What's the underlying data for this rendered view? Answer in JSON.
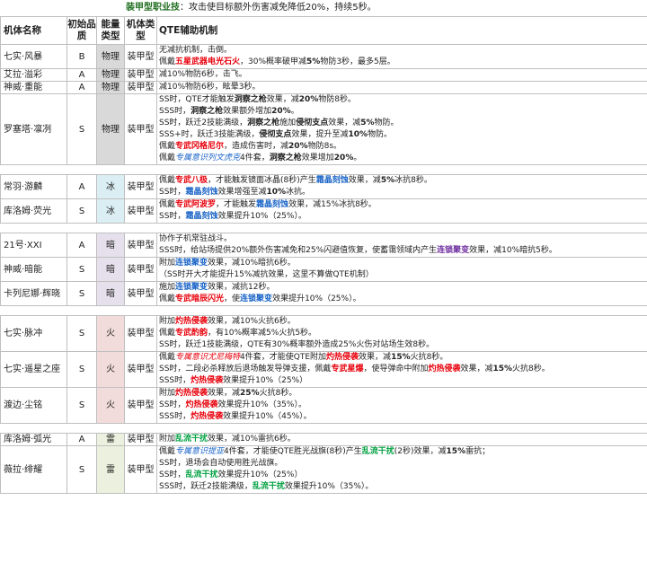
{
  "intro": {
    "label": "装甲型职业技",
    "text": "：攻击使目标额外伤害减免降低20%，持续5秒。"
  },
  "headers": {
    "name": "机体名称",
    "grade": "初始品质",
    "etype": "能量类型",
    "mtype": "机体类型",
    "mech": "QTE辅助机制"
  },
  "rows": [
    {
      "name": "七实·风暴",
      "grade": "B",
      "etype": "物理",
      "mtype": "装甲型",
      "lines": [
        [
          {
            "t": "无减抗机制，击倒。"
          }
        ],
        [
          {
            "t": "佩戴"
          },
          {
            "t": "五星武器电光石火",
            "c": "r"
          },
          {
            "t": "，30%概率破甲减"
          },
          {
            "t": "5%",
            "c": "k"
          },
          {
            "t": "物防3秒，最多5层。"
          }
        ]
      ]
    },
    {
      "name": "艾拉·溢彩",
      "grade": "A",
      "etype": "物理",
      "mtype": "装甲型",
      "lines": [
        [
          {
            "t": "减10%物防6秒，击飞。"
          }
        ]
      ]
    },
    {
      "name": "神威·重能",
      "grade": "A",
      "etype": "物理",
      "mtype": "装甲型",
      "lines": [
        [
          {
            "t": "减10%物防6秒，眩晕3秒。"
          }
        ]
      ]
    },
    {
      "name": "罗塞塔·凛冽",
      "grade": "S",
      "etype": "物理",
      "mtype": "装甲型",
      "lines": [
        [
          {
            "t": "SS时，QTE才能触发"
          },
          {
            "t": "洞察之枪",
            "c": "k"
          },
          {
            "t": "效果，减"
          },
          {
            "t": "20%",
            "c": "k"
          },
          {
            "t": "物防8秒。"
          }
        ],
        [
          {
            "t": "SSS时，"
          },
          {
            "t": "洞察之枪",
            "c": "k"
          },
          {
            "t": "效果额外增加"
          },
          {
            "t": "20%",
            "c": "k"
          },
          {
            "t": "。"
          }
        ],
        [
          {
            "t": "SS时，跃迁2技能满级，"
          },
          {
            "t": "洞察之枪",
            "c": "k"
          },
          {
            "t": "施加"
          },
          {
            "t": "侵彻支点",
            "c": "k"
          },
          {
            "t": "效果，减"
          },
          {
            "t": "5%",
            "c": "k"
          },
          {
            "t": "物防。"
          }
        ],
        [
          {
            "t": "SSS+时，跃迁3技能满级，"
          },
          {
            "t": "侵彻支点",
            "c": "k"
          },
          {
            "t": "效果，提升至减"
          },
          {
            "t": "10%",
            "c": "k"
          },
          {
            "t": "物防。"
          }
        ],
        [
          {
            "t": "佩戴"
          },
          {
            "t": "专武冈格尼尔",
            "c": "r"
          },
          {
            "t": "，造成伤害时，减"
          },
          {
            "t": "20%",
            "c": "k"
          },
          {
            "t": "物防8s。"
          }
        ],
        [
          {
            "t": "佩戴"
          },
          {
            "t": "专属意识列文虎克",
            "c": "bi"
          },
          {
            "t": "4件套，"
          },
          {
            "t": "洞察之枪",
            "c": "k"
          },
          {
            "t": "效果增加"
          },
          {
            "t": "20%",
            "c": "k"
          },
          {
            "t": "。"
          }
        ]
      ]
    },
    {
      "name": "常羽·游麟",
      "grade": "A",
      "etype": "冰",
      "mtype": "装甲型",
      "lines": [
        [
          {
            "t": "佩戴"
          },
          {
            "t": "专武八极",
            "c": "r"
          },
          {
            "t": "，才能触发镜面冰晶(8秒)产生"
          },
          {
            "t": "霜晶刻蚀",
            "c": "b"
          },
          {
            "t": "效果，减"
          },
          {
            "t": "5%",
            "c": "k"
          },
          {
            "t": "冰抗8秒。"
          }
        ],
        [
          {
            "t": "SS时，"
          },
          {
            "t": "霜晶刻蚀",
            "c": "b"
          },
          {
            "t": "效果增强至减"
          },
          {
            "t": "10%",
            "c": "k"
          },
          {
            "t": "冰抗。"
          }
        ]
      ]
    },
    {
      "name": "库洛姆·荧光",
      "grade": "S",
      "etype": "冰",
      "mtype": "装甲型",
      "lines": [
        [
          {
            "t": "佩戴"
          },
          {
            "t": "专武阿波罗",
            "c": "r"
          },
          {
            "t": "，才能触发"
          },
          {
            "t": "霜晶刻蚀",
            "c": "b"
          },
          {
            "t": "效果，减15%冰抗8秒。"
          }
        ],
        [
          {
            "t": "SS时，"
          },
          {
            "t": "霜晶刻蚀",
            "c": "b"
          },
          {
            "t": "效果提升10%（25%）。"
          }
        ]
      ]
    },
    {
      "name": "21号·XXI",
      "grade": "A",
      "etype": "暗",
      "mtype": "装甲型",
      "lines": [
        [
          {
            "t": "协作子机常驻战斗。"
          }
        ],
        [
          {
            "t": "SSS时，给站场提供20%额外伤害减免和25%闪避值恢复，使蓄霭领域内产生"
          },
          {
            "t": "连锁聚变",
            "c": "p"
          },
          {
            "t": "效果，减10%暗抗5秒。"
          }
        ]
      ]
    },
    {
      "name": "神威·暗能",
      "grade": "S",
      "etype": "暗",
      "mtype": "装甲型",
      "lines": [
        [
          {
            "t": "附加"
          },
          {
            "t": "连锁聚变",
            "c": "b"
          },
          {
            "t": "效果，减10%暗抗6秒。"
          }
        ],
        [
          {
            "t": "（SS时开大才能提升15%减抗效果，这里不算做QTE机制）"
          }
        ]
      ]
    },
    {
      "name": "卡列尼娜·辉晓",
      "grade": "S",
      "etype": "暗",
      "mtype": "装甲型",
      "lines": [
        [
          {
            "t": "施加"
          },
          {
            "t": "连锁聚变",
            "c": "b"
          },
          {
            "t": "效果，减抗12秒。"
          }
        ],
        [
          {
            "t": "佩戴"
          },
          {
            "t": "专武暗辰闪光",
            "c": "r"
          },
          {
            "t": "，使"
          },
          {
            "t": "连锁聚变",
            "c": "b"
          },
          {
            "t": "效果提升10%（25%）。"
          }
        ]
      ]
    },
    {
      "name": "七实·脉冲",
      "grade": "S",
      "etype": "火",
      "mtype": "装甲型",
      "lines": [
        [
          {
            "t": "附加"
          },
          {
            "t": "灼热侵袭",
            "c": "r"
          },
          {
            "t": "效果，减10%火抗6秒。"
          }
        ],
        [
          {
            "t": "佩戴"
          },
          {
            "t": "专武酌韵",
            "c": "r"
          },
          {
            "t": "，有10%概率减5%火抗5秒。"
          }
        ],
        [
          {
            "t": "SS时，跃迁1技能满级，QTE有30%概率额外造成25%火伤对站场生效8秒。"
          }
        ]
      ]
    },
    {
      "name": "七实·遥星之座",
      "grade": "S",
      "etype": "火",
      "mtype": "装甲型",
      "lines": [
        [
          {
            "t": "佩戴"
          },
          {
            "t": "专属意识尤尼梅特",
            "c": "ri"
          },
          {
            "t": "4件套，才能使QTE附加"
          },
          {
            "t": "灼热侵袭",
            "c": "r"
          },
          {
            "t": "效果，减"
          },
          {
            "t": "15%",
            "c": "k"
          },
          {
            "t": "火抗8秒。"
          }
        ],
        [
          {
            "t": "SS时，二段必杀释放后退场触发导弹支援，佩戴"
          },
          {
            "t": "专武星爆",
            "c": "r"
          },
          {
            "t": "，使导弹命中附加"
          },
          {
            "t": "灼热侵袭",
            "c": "r"
          },
          {
            "t": "效果，减"
          },
          {
            "t": "15%",
            "c": "k"
          },
          {
            "t": "火抗8秒。"
          }
        ],
        [
          {
            "t": "SSS时，"
          },
          {
            "t": "灼热侵袭",
            "c": "r"
          },
          {
            "t": "效果提升10%（25%）"
          }
        ]
      ]
    },
    {
      "name": "渡边·尘铭",
      "grade": "S",
      "etype": "火",
      "mtype": "装甲型",
      "lines": [
        [
          {
            "t": "附加"
          },
          {
            "t": "灼热侵袭",
            "c": "r"
          },
          {
            "t": "效果，减"
          },
          {
            "t": "25%",
            "c": "k"
          },
          {
            "t": "火抗8秒。"
          }
        ],
        [
          {
            "t": "SS时，"
          },
          {
            "t": "灼热侵袭",
            "c": "r"
          },
          {
            "t": "效果提升10%（35%）。"
          }
        ],
        [
          {
            "t": "SSS时，"
          },
          {
            "t": "灼热侵袭",
            "c": "r"
          },
          {
            "t": "效果提升10%（45%）。"
          }
        ]
      ]
    },
    {
      "name": "库洛姆·弧光",
      "grade": "A",
      "etype": "雷",
      "mtype": "装甲型",
      "lines": [
        [
          {
            "t": "附加"
          },
          {
            "t": "乱流干扰",
            "c": "g"
          },
          {
            "t": "效果，减10%雷抗6秒。"
          }
        ]
      ]
    },
    {
      "name": "薇拉·绯耀",
      "grade": "S",
      "etype": "雷",
      "mtype": "装甲型",
      "lines": [
        [
          {
            "t": "佩戴"
          },
          {
            "t": "专属意识提亚",
            "c": "bi"
          },
          {
            "t": "4件套，才能使QTE胜光战旗(8秒)产生"
          },
          {
            "t": "乱流干扰",
            "c": "g"
          },
          {
            "t": "(2秒)效果，减"
          },
          {
            "t": "15%",
            "c": "k"
          },
          {
            "t": "雷抗；"
          }
        ],
        [
          {
            "t": "SS时，退场会自动使用胜光战旗。"
          }
        ],
        [
          {
            "t": "SS时，"
          },
          {
            "t": "乱流干扰",
            "c": "g"
          },
          {
            "t": "效果提升10%（25%）"
          }
        ],
        [
          {
            "t": "SSS时，跃迁2技能满级，"
          },
          {
            "t": "乱流干扰",
            "c": "g"
          },
          {
            "t": "效果提升10%（35%）。"
          }
        ]
      ]
    }
  ]
}
